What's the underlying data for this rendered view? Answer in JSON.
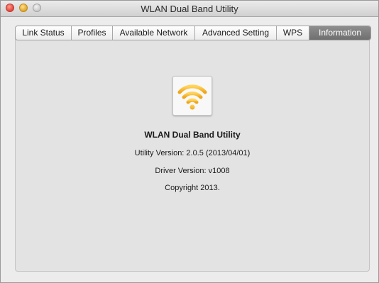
{
  "window": {
    "title": "WLAN Dual Band Utility"
  },
  "tabs": [
    {
      "label": "Link Status",
      "active": false
    },
    {
      "label": "Profiles",
      "active": false
    },
    {
      "label": "Available Network",
      "active": false
    },
    {
      "label": "Advanced Setting",
      "active": false
    },
    {
      "label": "WPS",
      "active": false
    },
    {
      "label": "Information",
      "active": true
    }
  ],
  "information": {
    "icon": "wifi-icon",
    "app_name": "WLAN Dual Band Utility",
    "utility_version": "Utility Version: 2.0.5 (2013/04/01)",
    "driver_version": "Driver Version: v1008",
    "copyright": "Copyright 2013."
  },
  "colors": {
    "active_tab": "#7a7a7a",
    "wifi_icon": "#f0b323"
  }
}
